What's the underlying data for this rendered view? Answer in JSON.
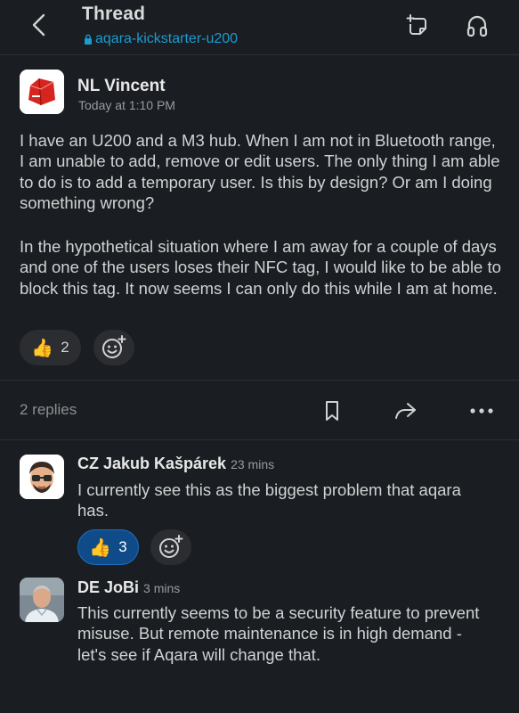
{
  "header": {
    "title": "Thread",
    "channel": "aqara-kickstarter-u200"
  },
  "post": {
    "author": "NL Vincent",
    "time": "Today at 1:10 PM",
    "paragraphs": [
      "I have an U200 and a M3 hub. When I am not in Bluetooth range, I am unable to add, remove or edit users. The only thing I am able to do is to add a temporary user. Is this by design? Or am I doing something wrong?",
      "In the hypothetical situation where I am away for a couple of days and one of the users loses their NFC tag, I would like to be able to block this tag. It now seems I can only do this while I am at home."
    ],
    "reaction": {
      "emoji": "👍",
      "count": "2"
    }
  },
  "thread_bar": {
    "replies_label": "2 replies"
  },
  "replies": [
    {
      "author": "CZ Jakub Kašpárek",
      "time": "23 mins",
      "text": "I currently see this as the biggest problem that aqara has.",
      "reaction": {
        "emoji": "👍",
        "count": "3"
      }
    },
    {
      "author": "DE JoBi",
      "time": "3 mins",
      "text": "This currently seems to be a security feature to prevent misuse. But remote maintenance is in high demand - let's see if Aqara will change that."
    }
  ],
  "colors": {
    "background": "#1a1d21",
    "link": "#1d9bd1",
    "active_reaction": "#0f4b88"
  },
  "icons": [
    "back-icon",
    "lock-icon",
    "new-note-icon",
    "headphones-icon",
    "bookmark-icon",
    "share-icon",
    "more-icon",
    "add-emoji-icon"
  ]
}
